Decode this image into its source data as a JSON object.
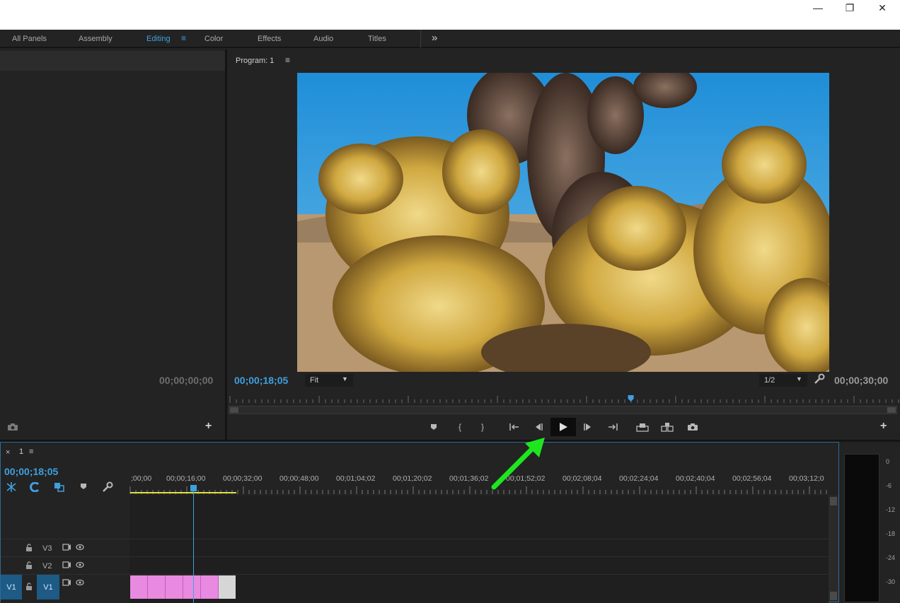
{
  "window": {
    "minimize_glyph": "—",
    "maximize_glyph": "❐",
    "close_glyph": "✕"
  },
  "workspaces": {
    "tabs": [
      "All Panels",
      "Assembly",
      "Editing",
      "Color",
      "Effects",
      "Audio",
      "Titles"
    ],
    "active": "Editing",
    "overflow_glyph": "»"
  },
  "source_panel": {
    "timecode": "00;00;00;00"
  },
  "program": {
    "title": "Program: 1",
    "menu_glyph": "≡",
    "current_timecode": "00;00;18;05",
    "zoom_value": "Fit",
    "resolution_value": "1/2",
    "duration_timecode": "00;00;30;00",
    "playhead_fraction": 0.6,
    "image_subject": "cholla-cactus-photo"
  },
  "timeline": {
    "sequence_name": "1",
    "close_glyph": "×",
    "menu_glyph": "≡",
    "current_timecode": "00;00;18;05",
    "ruler_labels": [
      ";00;00",
      "00;00;16;00",
      "00;00;32;00",
      "00;00;48;00",
      "00;01;04;02",
      "00;01;20;02",
      "00;01;36;02",
      "00;01;52;02",
      "00;02;08;04",
      "00;02;24;04",
      "00;02;40;04",
      "00;02;56;04",
      "00;03;12;0"
    ],
    "tracks": [
      {
        "name": "V3"
      },
      {
        "name": "V2"
      },
      {
        "name": "V1",
        "source": "V1"
      }
    ]
  },
  "audio_meter": {
    "labels": [
      "0",
      "-6",
      "-12",
      "-18",
      "-24",
      "-30"
    ]
  },
  "colors": {
    "accent": "#3fa0e0",
    "clip": "#e88ae0",
    "annotation_arrow": "#1ee61e",
    "work_area": "#e0e040"
  }
}
